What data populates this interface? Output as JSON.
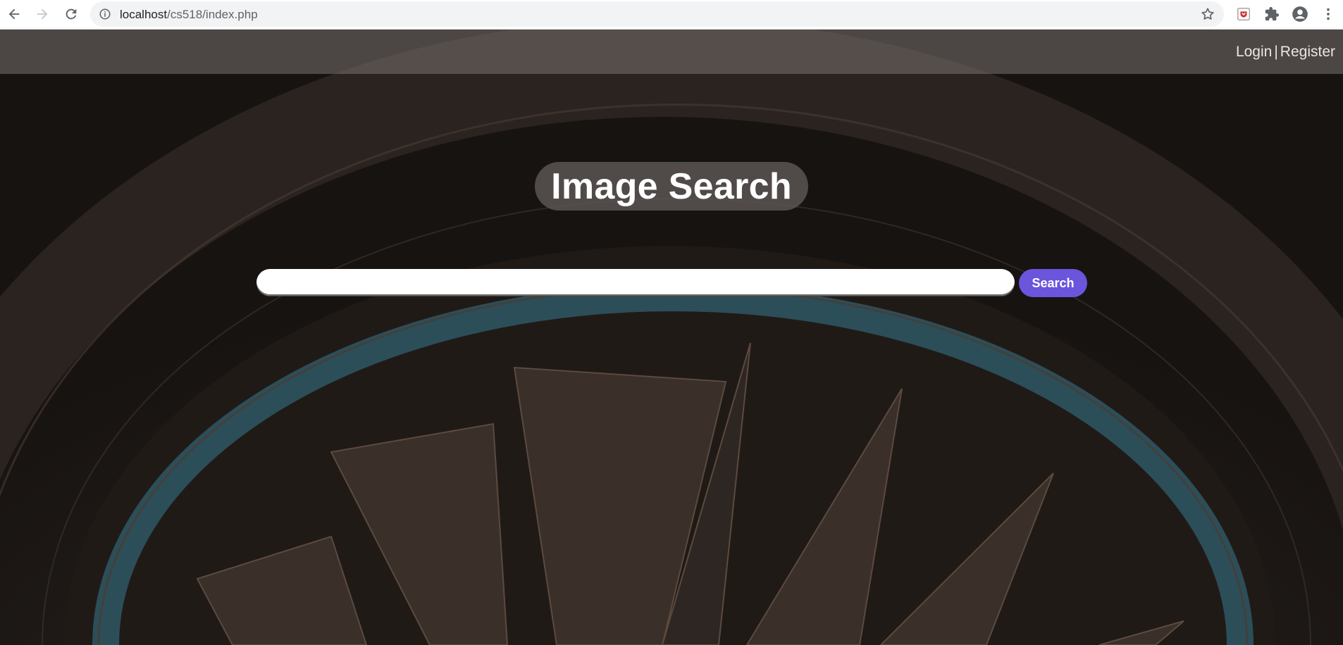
{
  "browser": {
    "url_host": "localhost",
    "url_path": "/cs518/index.php"
  },
  "nav": {
    "login": "Login",
    "separator": "|",
    "register": "Register"
  },
  "hero": {
    "title": "Image Search"
  },
  "search": {
    "value": "",
    "placeholder": "",
    "button_label": "Search"
  },
  "colors": {
    "search_button": "#6a55dc",
    "ring_accent": "#2f5865"
  },
  "icons": {
    "back": "arrow-left-icon",
    "forward": "arrow-right-icon",
    "reload": "reload-icon",
    "site_info": "info-icon",
    "bookmark": "star-icon",
    "extension_1": "pocket-icon",
    "extensions": "puzzle-icon",
    "profile": "account-icon",
    "menu": "kebab-menu-icon"
  }
}
